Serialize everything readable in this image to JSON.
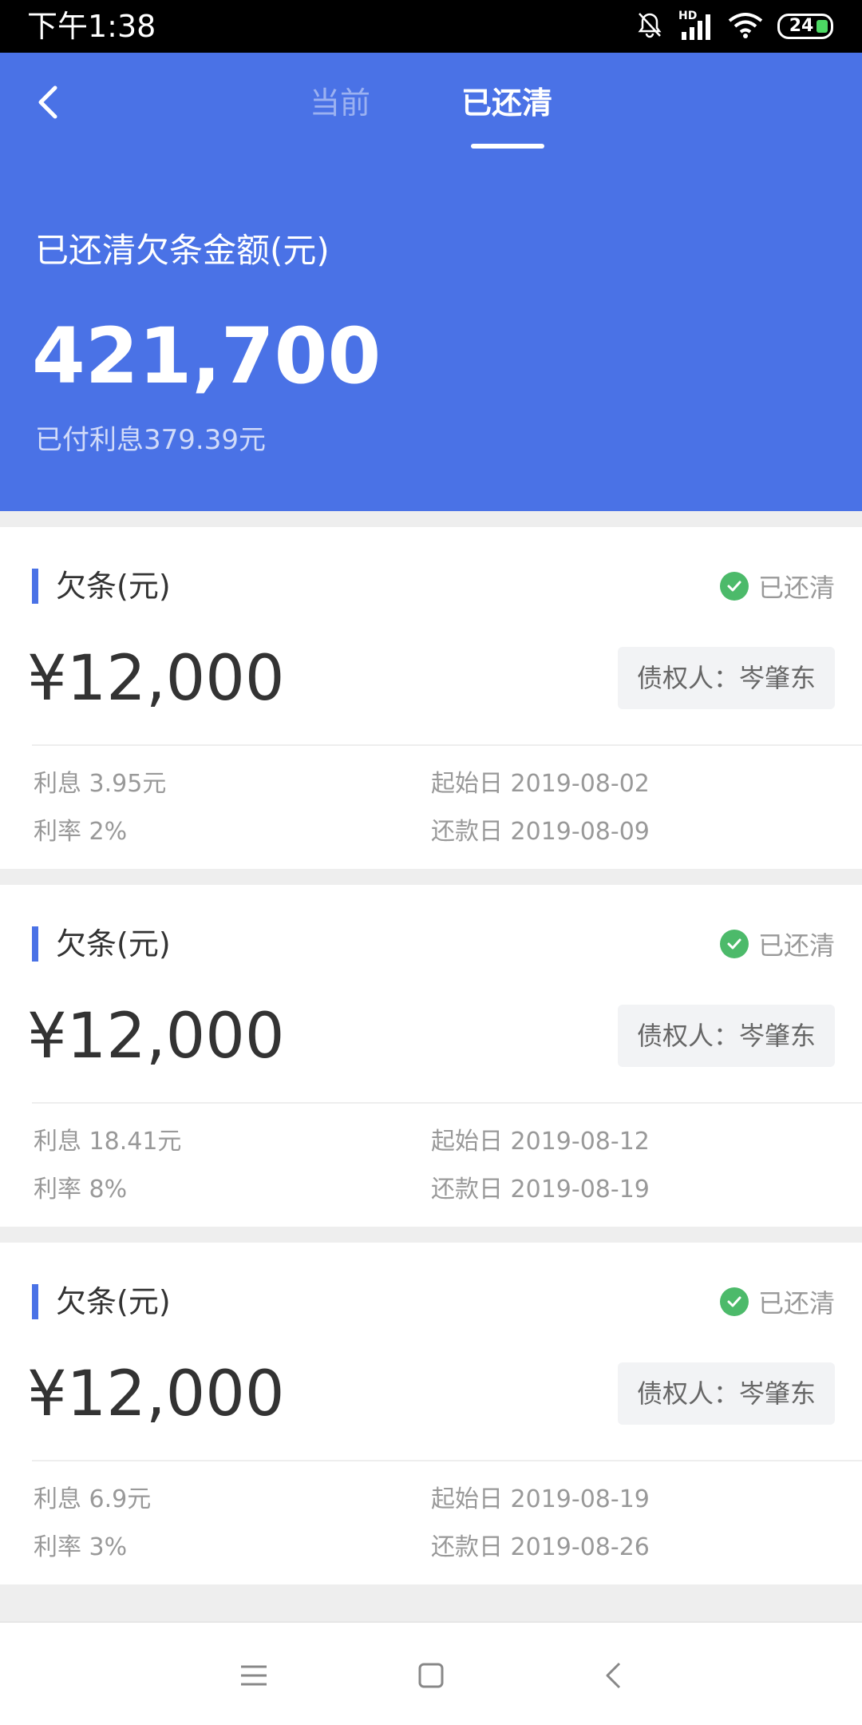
{
  "status_bar": {
    "time": "下午1:38",
    "network": "HD",
    "battery": "24"
  },
  "header": {
    "tabs": [
      {
        "label": "当前",
        "active": false
      },
      {
        "label": "已还清",
        "active": true
      }
    ],
    "summary_label": "已还清欠条金额(元)",
    "summary_amount": "421,700",
    "paid_interest": "已付利息379.39元",
    "accent_color": "#4a72e6"
  },
  "cards": [
    {
      "title": "欠条(元)",
      "status": "已还清",
      "amount": "¥12,000",
      "creditor": "债权人：岑肇东",
      "interest": "利息 3.95元",
      "rate": "利率 2%",
      "start_date": "起始日 2019-08-02",
      "repay_date": "还款日 2019-08-09"
    },
    {
      "title": "欠条(元)",
      "status": "已还清",
      "amount": "¥12,000",
      "creditor": "债权人：岑肇东",
      "interest": "利息 18.41元",
      "rate": "利率 8%",
      "start_date": "起始日 2019-08-12",
      "repay_date": "还款日 2019-08-19"
    },
    {
      "title": "欠条(元)",
      "status": "已还清",
      "amount": "¥12,000",
      "creditor": "债权人：岑肇东",
      "interest": "利息 6.9元",
      "rate": "利率 3%",
      "start_date": "起始日 2019-08-19",
      "repay_date": "还款日 2019-08-26"
    }
  ],
  "icons": {
    "back": "chevron-left-icon",
    "status_check": "check-circle-icon",
    "nav_menu": "menu-icon",
    "nav_home": "square-icon",
    "nav_back": "back-icon"
  }
}
